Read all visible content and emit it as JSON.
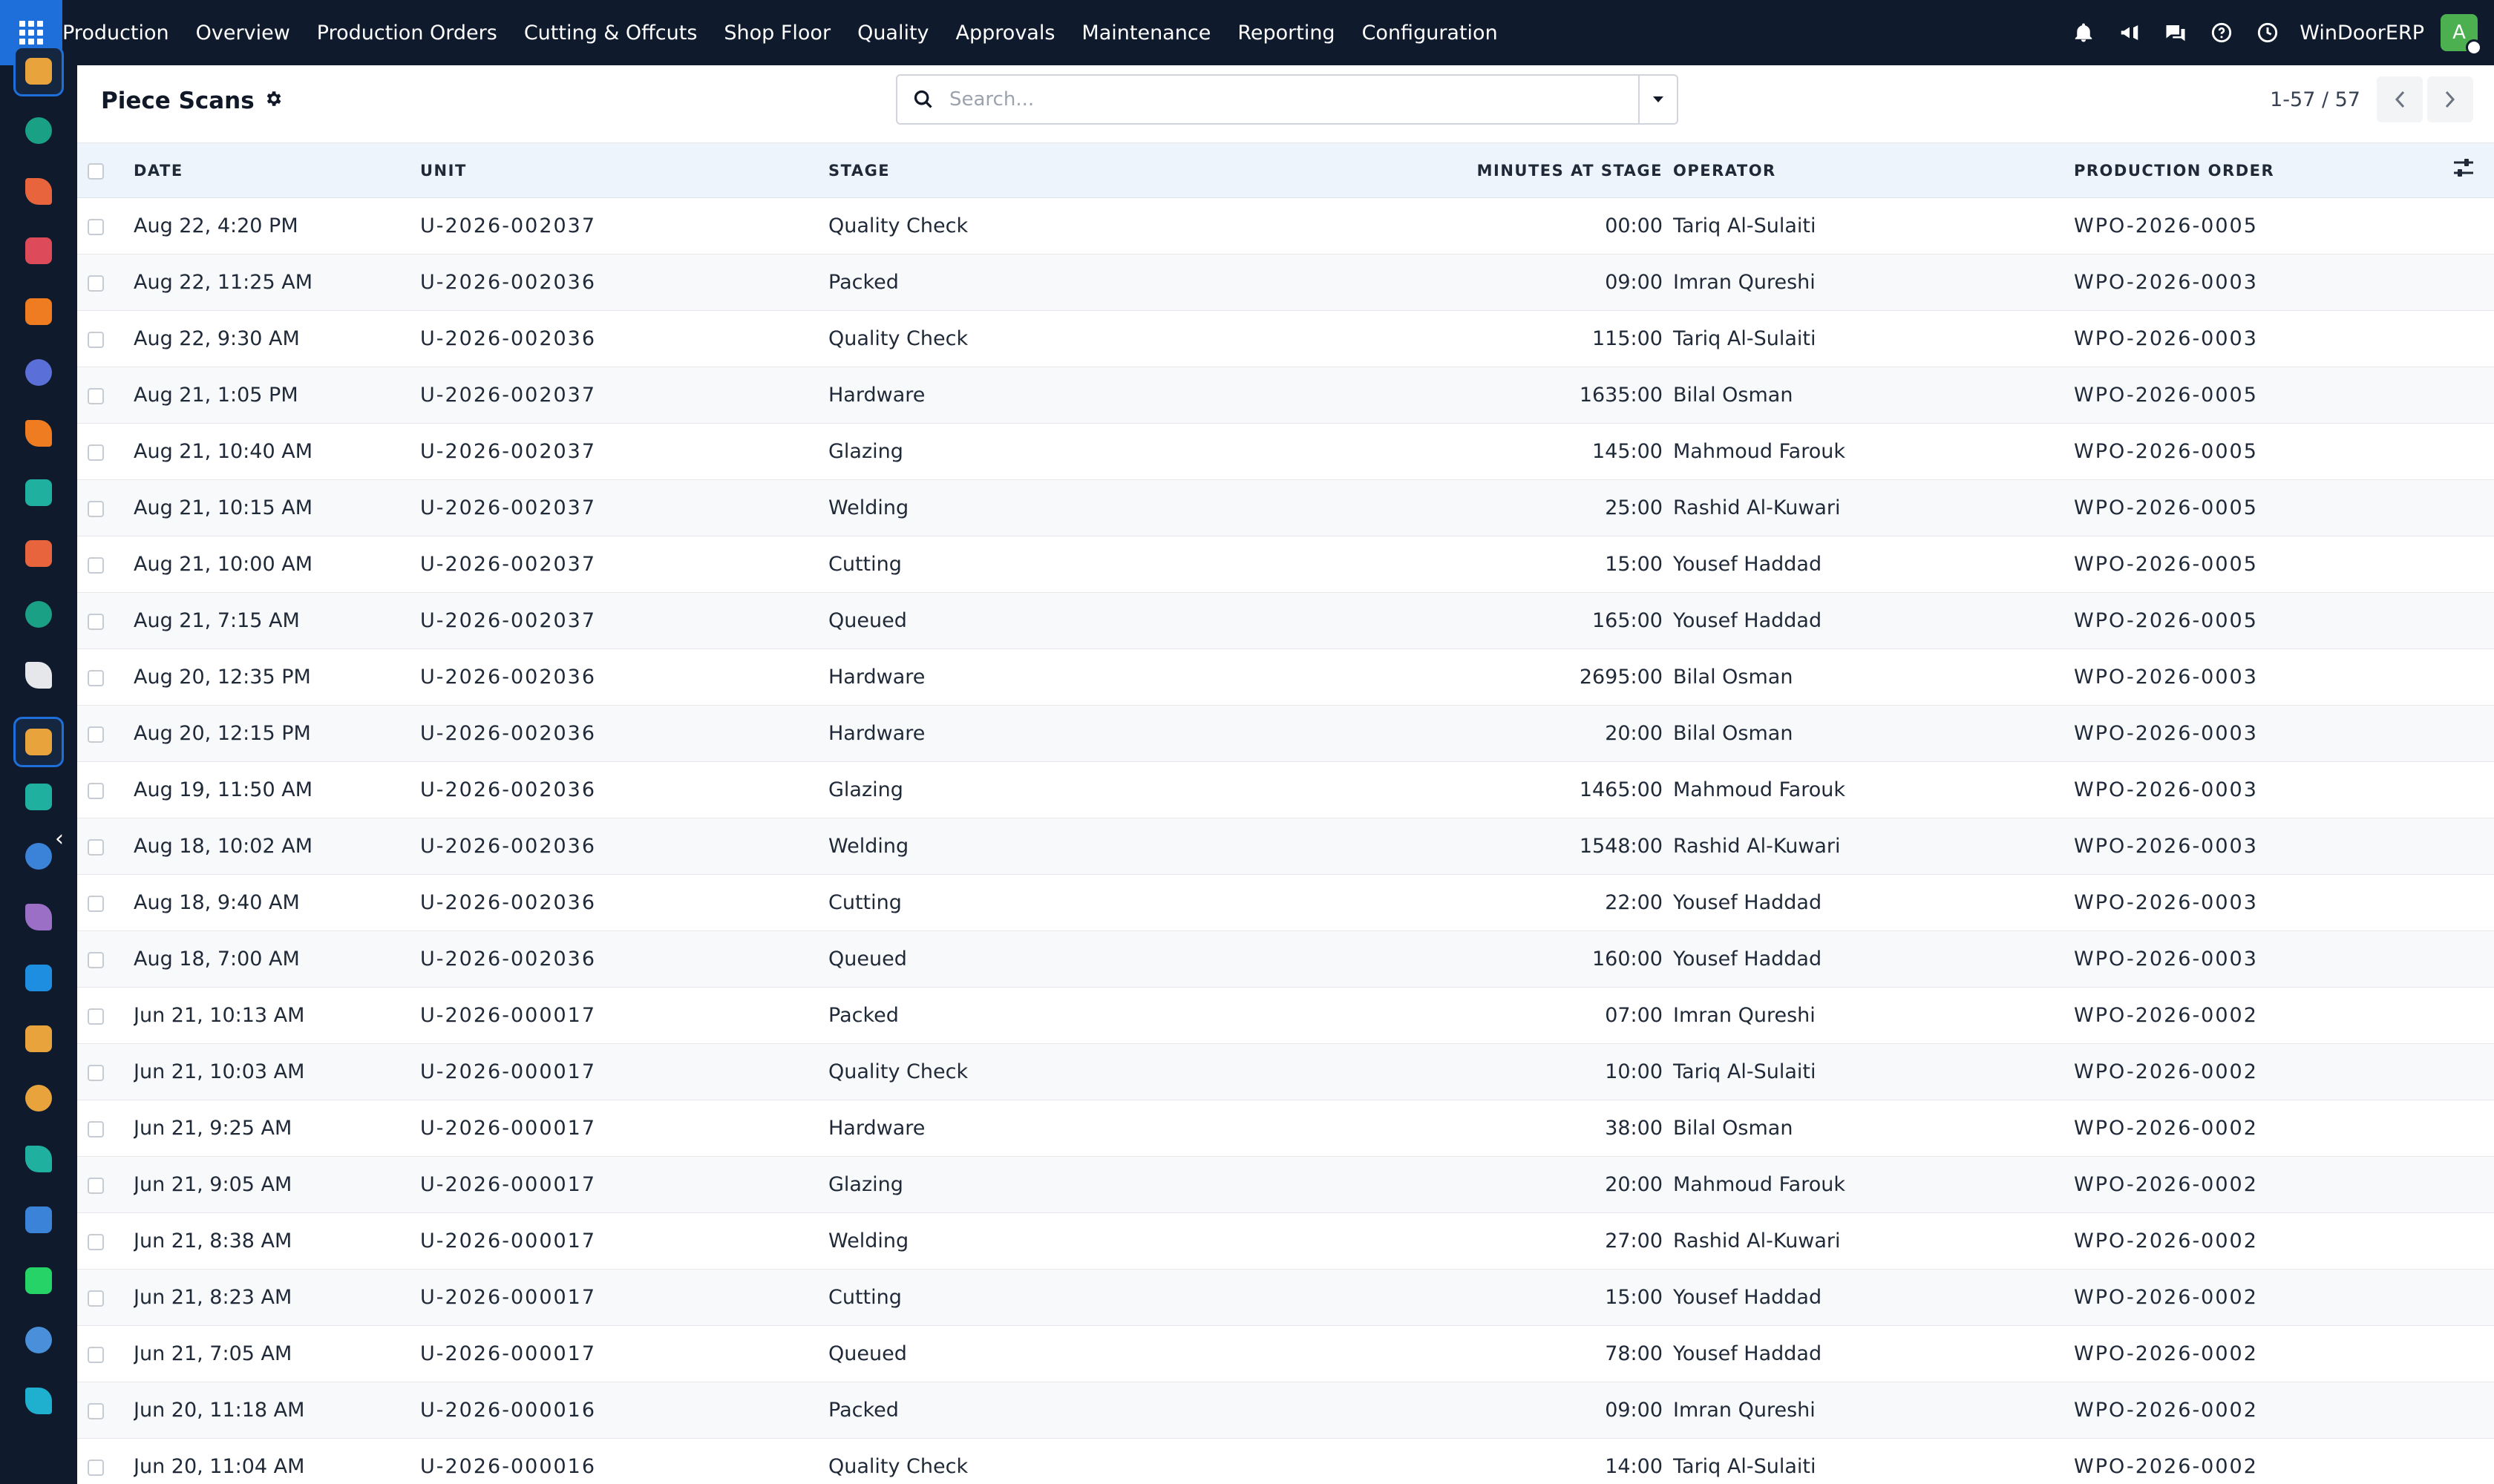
{
  "nav": {
    "brand": "Production",
    "menu": [
      "Overview",
      "Production Orders",
      "Cutting & Offcuts",
      "Shop Floor",
      "Quality",
      "Approvals",
      "Maintenance",
      "Reporting",
      "Configuration"
    ],
    "company": "WinDoorERP",
    "avatar_letter": "A",
    "tool_icons": [
      "bell-icon",
      "megaphone-icon",
      "chat-icon",
      "help-icon",
      "clock-icon"
    ]
  },
  "sidebar_apps": [
    {
      "icon": "production-app-icon",
      "color": "#e8a33d",
      "active": true
    },
    {
      "icon": "contacts-app-icon",
      "color": "#19a085"
    },
    {
      "icon": "reporting-app-icon",
      "color": "#e8643d"
    },
    {
      "icon": "dashboard-app-icon",
      "color": "#dd4b5a"
    },
    {
      "icon": "discuss-app-icon",
      "color": "#f07c21"
    },
    {
      "icon": "mail-app-icon",
      "color": "#5b6fd9"
    },
    {
      "icon": "livechat-app-icon",
      "color": "#f07c21"
    },
    {
      "icon": "inventory-app-icon",
      "color": "#1fb0a0"
    },
    {
      "icon": "analytics-app-icon",
      "color": "#e8643d"
    },
    {
      "icon": "employees-app-icon",
      "color": "#19a085"
    },
    {
      "icon": "product-app-icon",
      "color": "#e5e7eb"
    },
    {
      "icon": "production-app-icon-2",
      "color": "#e8a33d",
      "active": true
    },
    {
      "icon": "quality-app-icon",
      "color": "#1fb0a0"
    },
    {
      "icon": "knowledge-app-icon",
      "color": "#3b82d9"
    },
    {
      "icon": "packages-app-icon",
      "color": "#9b6fc6"
    },
    {
      "icon": "accounting-app-icon",
      "color": "#1e8fe0"
    },
    {
      "icon": "team-app-icon",
      "color": "#e8a33d"
    },
    {
      "icon": "calendar-app-icon",
      "color": "#e8a33d"
    },
    {
      "icon": "sign-app-icon",
      "color": "#1fb0a0"
    },
    {
      "icon": "website-app-icon",
      "color": "#3b82d9"
    },
    {
      "icon": "whatsapp-app-icon",
      "color": "#25d366"
    },
    {
      "icon": "planning-app-icon",
      "color": "#4a8fd9"
    },
    {
      "icon": "helpdesk-app-icon",
      "color": "#1fb0d0"
    }
  ],
  "control": {
    "title": "Piece Scans",
    "search_placeholder": "Search...",
    "pager": "1-57 / 57"
  },
  "table": {
    "columns": [
      "DATE",
      "UNIT",
      "STAGE",
      "MINUTES AT STAGE",
      "OPERATOR",
      "PRODUCTION ORDER"
    ],
    "rows": [
      {
        "date": "Aug 22, 4:20 PM",
        "unit": "U-2026-002037",
        "stage": "Quality Check",
        "minutes": "00:00",
        "operator": "Tariq Al-Sulaiti",
        "po": "WPO-2026-0005"
      },
      {
        "date": "Aug 22, 11:25 AM",
        "unit": "U-2026-002036",
        "stage": "Packed",
        "minutes": "09:00",
        "operator": "Imran Qureshi",
        "po": "WPO-2026-0003"
      },
      {
        "date": "Aug 22, 9:30 AM",
        "unit": "U-2026-002036",
        "stage": "Quality Check",
        "minutes": "115:00",
        "operator": "Tariq Al-Sulaiti",
        "po": "WPO-2026-0003"
      },
      {
        "date": "Aug 21, 1:05 PM",
        "unit": "U-2026-002037",
        "stage": "Hardware",
        "minutes": "1635:00",
        "operator": "Bilal Osman",
        "po": "WPO-2026-0005"
      },
      {
        "date": "Aug 21, 10:40 AM",
        "unit": "U-2026-002037",
        "stage": "Glazing",
        "minutes": "145:00",
        "operator": "Mahmoud Farouk",
        "po": "WPO-2026-0005"
      },
      {
        "date": "Aug 21, 10:15 AM",
        "unit": "U-2026-002037",
        "stage": "Welding",
        "minutes": "25:00",
        "operator": "Rashid Al-Kuwari",
        "po": "WPO-2026-0005"
      },
      {
        "date": "Aug 21, 10:00 AM",
        "unit": "U-2026-002037",
        "stage": "Cutting",
        "minutes": "15:00",
        "operator": "Yousef Haddad",
        "po": "WPO-2026-0005"
      },
      {
        "date": "Aug 21, 7:15 AM",
        "unit": "U-2026-002037",
        "stage": "Queued",
        "minutes": "165:00",
        "operator": "Yousef Haddad",
        "po": "WPO-2026-0005"
      },
      {
        "date": "Aug 20, 12:35 PM",
        "unit": "U-2026-002036",
        "stage": "Hardware",
        "minutes": "2695:00",
        "operator": "Bilal Osman",
        "po": "WPO-2026-0003"
      },
      {
        "date": "Aug 20, 12:15 PM",
        "unit": "U-2026-002036",
        "stage": "Hardware",
        "minutes": "20:00",
        "operator": "Bilal Osman",
        "po": "WPO-2026-0003"
      },
      {
        "date": "Aug 19, 11:50 AM",
        "unit": "U-2026-002036",
        "stage": "Glazing",
        "minutes": "1465:00",
        "operator": "Mahmoud Farouk",
        "po": "WPO-2026-0003"
      },
      {
        "date": "Aug 18, 10:02 AM",
        "unit": "U-2026-002036",
        "stage": "Welding",
        "minutes": "1548:00",
        "operator": "Rashid Al-Kuwari",
        "po": "WPO-2026-0003"
      },
      {
        "date": "Aug 18, 9:40 AM",
        "unit": "U-2026-002036",
        "stage": "Cutting",
        "minutes": "22:00",
        "operator": "Yousef Haddad",
        "po": "WPO-2026-0003"
      },
      {
        "date": "Aug 18, 7:00 AM",
        "unit": "U-2026-002036",
        "stage": "Queued",
        "minutes": "160:00",
        "operator": "Yousef Haddad",
        "po": "WPO-2026-0003"
      },
      {
        "date": "Jun 21, 10:13 AM",
        "unit": "U-2026-000017",
        "stage": "Packed",
        "minutes": "07:00",
        "operator": "Imran Qureshi",
        "po": "WPO-2026-0002"
      },
      {
        "date": "Jun 21, 10:03 AM",
        "unit": "U-2026-000017",
        "stage": "Quality Check",
        "minutes": "10:00",
        "operator": "Tariq Al-Sulaiti",
        "po": "WPO-2026-0002"
      },
      {
        "date": "Jun 21, 9:25 AM",
        "unit": "U-2026-000017",
        "stage": "Hardware",
        "minutes": "38:00",
        "operator": "Bilal Osman",
        "po": "WPO-2026-0002"
      },
      {
        "date": "Jun 21, 9:05 AM",
        "unit": "U-2026-000017",
        "stage": "Glazing",
        "minutes": "20:00",
        "operator": "Mahmoud Farouk",
        "po": "WPO-2026-0002"
      },
      {
        "date": "Jun 21, 8:38 AM",
        "unit": "U-2026-000017",
        "stage": "Welding",
        "minutes": "27:00",
        "operator": "Rashid Al-Kuwari",
        "po": "WPO-2026-0002"
      },
      {
        "date": "Jun 21, 8:23 AM",
        "unit": "U-2026-000017",
        "stage": "Cutting",
        "minutes": "15:00",
        "operator": "Yousef Haddad",
        "po": "WPO-2026-0002"
      },
      {
        "date": "Jun 21, 7:05 AM",
        "unit": "U-2026-000017",
        "stage": "Queued",
        "minutes": "78:00",
        "operator": "Yousef Haddad",
        "po": "WPO-2026-0002"
      },
      {
        "date": "Jun 20, 11:18 AM",
        "unit": "U-2026-000016",
        "stage": "Packed",
        "minutes": "09:00",
        "operator": "Imran Qureshi",
        "po": "WPO-2026-0002"
      },
      {
        "date": "Jun 20, 11:04 AM",
        "unit": "U-2026-000016",
        "stage": "Quality Check",
        "minutes": "14:00",
        "operator": "Tariq Al-Sulaiti",
        "po": "WPO-2026-0002"
      }
    ]
  }
}
